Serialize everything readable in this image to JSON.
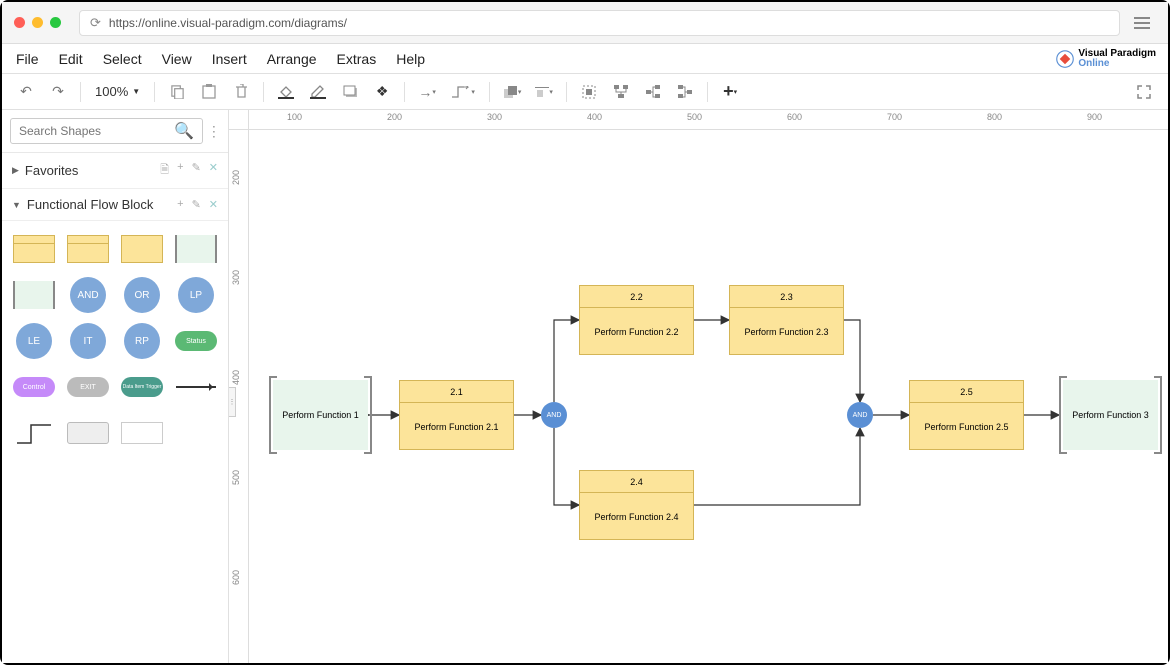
{
  "browser": {
    "url": "https://online.visual-paradigm.com/diagrams/"
  },
  "menu": [
    "File",
    "Edit",
    "Select",
    "View",
    "Insert",
    "Arrange",
    "Extras",
    "Help"
  ],
  "brand": {
    "line1": "Visual Paradigm",
    "line2": "Online"
  },
  "toolbar": {
    "zoom": "100%"
  },
  "sidebar": {
    "search_placeholder": "Search Shapes",
    "panels": {
      "favorites": "Favorites",
      "ffb": "Functional Flow Block"
    },
    "gates": {
      "and": "AND",
      "or": "OR",
      "lp": "LP",
      "le": "LE",
      "it": "IT",
      "rp": "RP"
    },
    "pills": {
      "status": "Status",
      "control": "Control",
      "exit": "EXIT",
      "trigger": "Data Item Trigger"
    }
  },
  "ruler_h": [
    "100",
    "200",
    "300",
    "400",
    "500",
    "600",
    "700",
    "800",
    "900"
  ],
  "ruler_v": [
    "200",
    "300",
    "400",
    "500",
    "600"
  ],
  "diagram": {
    "ref1": "Perform Function 1",
    "ref3": "Perform Function 3",
    "f21": {
      "num": "2.1",
      "label": "Perform Function 2.1"
    },
    "f22": {
      "num": "2.2",
      "label": "Perform Function 2.2"
    },
    "f23": {
      "num": "2.3",
      "label": "Perform Function 2.3"
    },
    "f24": {
      "num": "2.4",
      "label": "Perform Function 2.4"
    },
    "f25": {
      "num": "2.5",
      "label": "Perform Function 2.5"
    },
    "gate": "AND"
  }
}
